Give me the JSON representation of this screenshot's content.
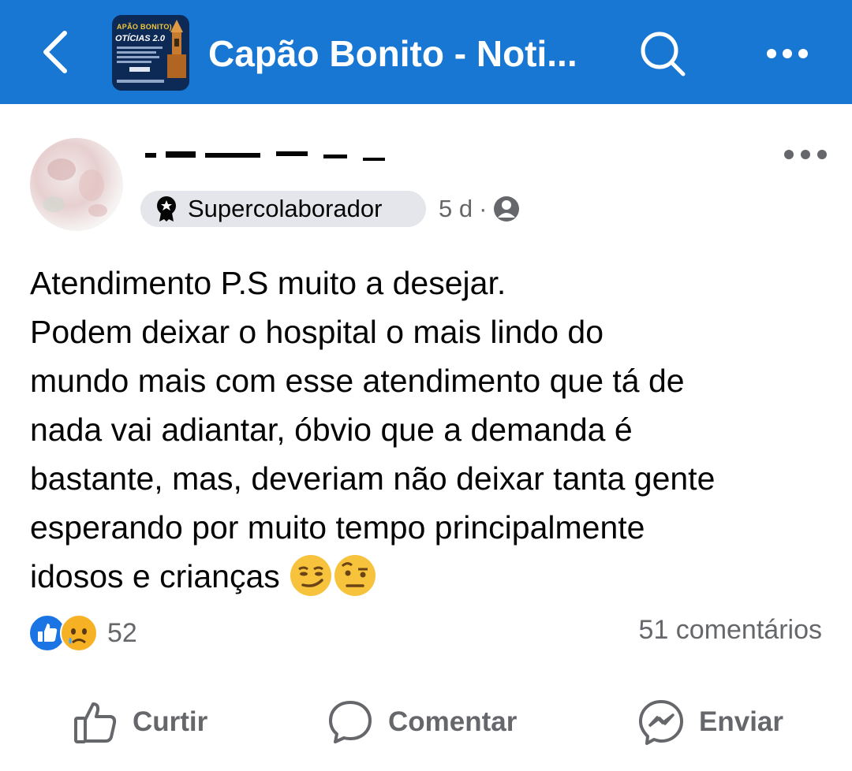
{
  "header": {
    "group_title": "Capão Bonito - Noti...",
    "thumb_line1": "APÃO BONITO)",
    "thumb_line2": "OTÍCIAS 2.0",
    "accent_color": "#1877d2",
    "icons": [
      "back-arrow-icon",
      "search-icon",
      "more-icon"
    ]
  },
  "post": {
    "badge_label": "Supercolaborador",
    "time": "5 d",
    "separator": "·",
    "privacy_icon": "globe-icon",
    "text_lines": [
      "Atendimento P.S muito a desejar.",
      "Podem deixar o hospital o mais lindo do",
      "mundo mais com esse atendimento que tá de",
      "nada vai adiantar, óbvio que a demanda é",
      "bastante, mas, deveriam não deixar tanta gente",
      "esperando por muito tempo principalmente",
      "idosos e crianças"
    ],
    "trailing_emojis": [
      "smirk-emoji",
      "raised-eyebrow-emoji"
    ]
  },
  "reactions": {
    "count": "52",
    "types": [
      "like",
      "sad"
    ],
    "comments": "51 comentários"
  },
  "actions": {
    "like": "Curtir",
    "comment": "Comentar",
    "send": "Enviar"
  }
}
